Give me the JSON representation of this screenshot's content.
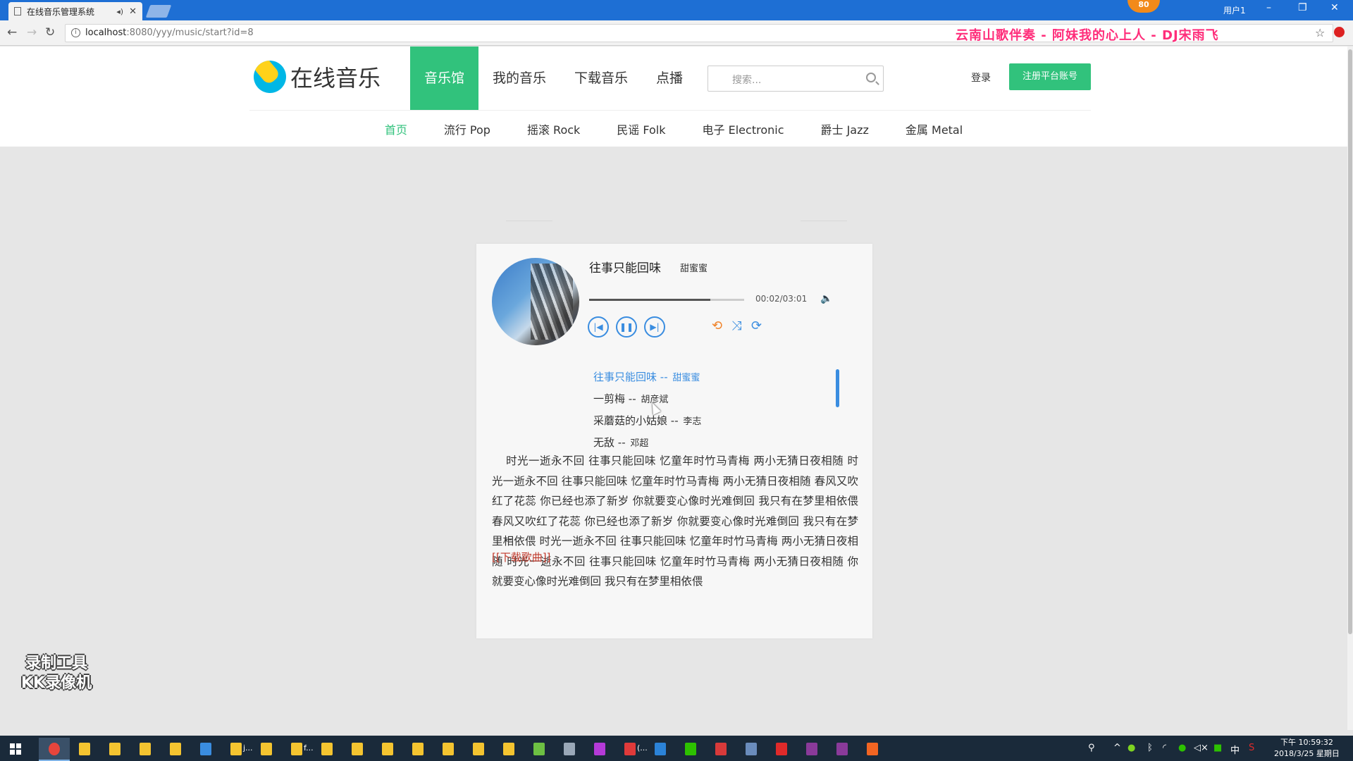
{
  "browser": {
    "tab_title": "在线音乐管理系统",
    "url_host": "localhost",
    "url_path": ":8080/yyy/music/start?id=8",
    "user": "用户1",
    "badge": "80",
    "overlay_song": "云南山歌伴奏 - 阿妹我的心上人 - DJ宋雨飞"
  },
  "site": {
    "logo_text": "在线音乐",
    "nav": [
      {
        "label": "音乐馆",
        "active": true
      },
      {
        "label": "我的音乐",
        "active": false
      },
      {
        "label": "下载音乐",
        "active": false
      },
      {
        "label": "点播",
        "active": false
      }
    ],
    "search_placeholder": "搜索...",
    "login": "登录",
    "register": "注册平台账号",
    "subnav": [
      {
        "label": "首页",
        "active": true
      },
      {
        "label": "流行 Pop",
        "active": false
      },
      {
        "label": "摇滚 Rock",
        "active": false
      },
      {
        "label": "民谣 Folk",
        "active": false
      },
      {
        "label": "电子 Electronic",
        "active": false
      },
      {
        "label": "爵士 Jazz",
        "active": false
      },
      {
        "label": "金属 Metal",
        "active": false
      }
    ]
  },
  "player": {
    "title": "往事只能回味",
    "artist": "甜蜜蜜",
    "time": "00:02/03:01",
    "progress": 0.78,
    "playlist": [
      {
        "song": "往事只能回味",
        "sep": " -- ",
        "artist": "甜蜜蜜",
        "active": true
      },
      {
        "song": "一剪梅",
        "sep": " -- ",
        "artist": "胡彦斌",
        "active": false
      },
      {
        "song": "采蘑菇的小姑娘",
        "sep": " -- ",
        "artist": "李志",
        "active": false
      },
      {
        "song": "无敌",
        "sep": " -- ",
        "artist": "邓超",
        "active": false
      }
    ],
    "lyrics": "时光一逝永不回 往事只能回味 忆童年时竹马青梅 两小无猜日夜相随 时光一逝永不回 往事只能回味 忆童年时竹马青梅 两小无猜日夜相随 春风又吹红了花蕊 你已经也添了新岁 你就要变心像时光难倒回 我只有在梦里相依偎 春风又吹红了花蕊 你已经也添了新岁 你就要变心像时光难倒回 我只有在梦里相依偎 时光一逝永不回 往事只能回味 忆童年时竹马青梅 两小无猜日夜相随 时光一逝永不回 往事只能回味 忆童年时竹马青梅 两小无猜日夜相随 你就要变心像时光难倒回 我只有在梦里相依偎",
    "dash": "--",
    "download": "[[下载歌曲]]"
  },
  "watermark": {
    "line1": "录制工具",
    "line2": "KK录像机"
  },
  "taskbar": {
    "clock_time": "下午 10:59:32",
    "clock_date": "2018/3/25 星期日",
    "ime": "中",
    "items": [
      {
        "icon": "chrome-icon",
        "color": "#e8453c",
        "label": ""
      },
      {
        "icon": "folder-icon",
        "color": "#f4c430",
        "label": ""
      },
      {
        "icon": "folder-icon",
        "color": "#f4c430",
        "label": ""
      },
      {
        "icon": "folder-icon",
        "color": "#f4c430",
        "label": ""
      },
      {
        "icon": "folder-icon",
        "color": "#f4c430",
        "label": ""
      },
      {
        "icon": "explorer-icon",
        "color": "#3a8de0",
        "label": ""
      },
      {
        "icon": "folder-icon",
        "color": "#f4c430",
        "label": "j..."
      },
      {
        "icon": "folder-icon",
        "color": "#f4c430",
        "label": ""
      },
      {
        "icon": "folder-icon",
        "color": "#f4c430",
        "label": "f..."
      },
      {
        "icon": "folder-icon",
        "color": "#f4c430",
        "label": ""
      },
      {
        "icon": "folder-icon",
        "color": "#f4c430",
        "label": ""
      },
      {
        "icon": "folder-icon",
        "color": "#f4c430",
        "label": ""
      },
      {
        "icon": "folder-icon",
        "color": "#f4c430",
        "label": ""
      },
      {
        "icon": "folder-icon",
        "color": "#f4c430",
        "label": ""
      },
      {
        "icon": "folder-icon",
        "color": "#f4c430",
        "label": ""
      },
      {
        "icon": "folder-icon",
        "color": "#f4c430",
        "label": ""
      },
      {
        "icon": "eclipse-icon",
        "color": "#6dc043",
        "label": ""
      },
      {
        "icon": "home-icon",
        "color": "#9aa8b8",
        "label": ""
      },
      {
        "icon": "phpstorm-icon",
        "color": "#b43ad8",
        "label": ""
      },
      {
        "icon": "git-icon",
        "color": "#e03a3a",
        "label": "(..."
      },
      {
        "icon": "word-icon",
        "color": "#2b83d8",
        "label": ""
      },
      {
        "icon": "wechat-icon",
        "color": "#2dc100",
        "label": ""
      },
      {
        "icon": "pdf-icon",
        "color": "#d83a3a",
        "label": ""
      },
      {
        "icon": "pen-icon",
        "color": "#6a8cbc",
        "label": ""
      },
      {
        "icon": "netease-music-icon",
        "color": "#e02a2a",
        "label": ""
      },
      {
        "icon": "winrar-icon",
        "color": "#8a3a9a",
        "label": ""
      },
      {
        "icon": "winrar-icon",
        "color": "#8a3a9a",
        "label": ""
      },
      {
        "icon": "sogou-icon",
        "color": "#f26522",
        "label": ""
      }
    ]
  },
  "colors": {
    "brand_green": "#31c27c",
    "player_blue": "#3a8de0",
    "mode_orange": "#f0832a",
    "download_red": "#c0392b"
  }
}
